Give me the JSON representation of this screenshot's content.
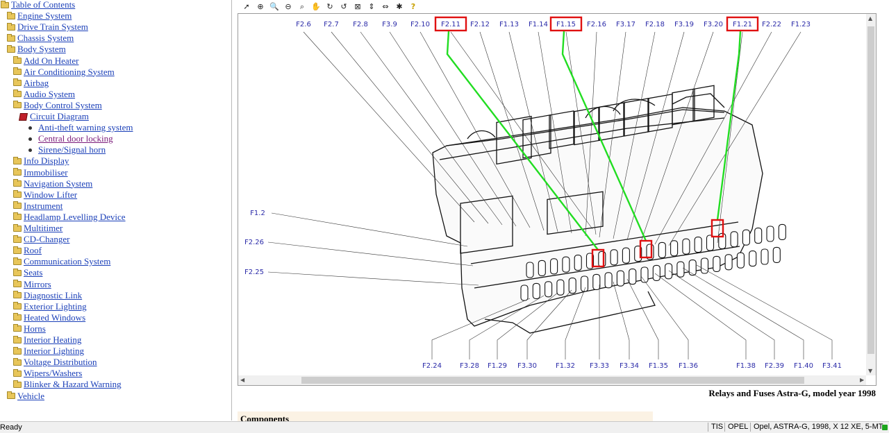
{
  "tree": {
    "items": [
      {
        "label": "Table of Contents",
        "icon": "open-folder-icon",
        "indent": 0
      },
      {
        "label": "Engine System",
        "icon": "folder-icon",
        "indent": 1
      },
      {
        "label": "Drive Train System",
        "icon": "folder-icon",
        "indent": 1
      },
      {
        "label": "Chassis System",
        "icon": "folder-icon",
        "indent": 1
      },
      {
        "label": "Body System",
        "icon": "open-folder-icon",
        "indent": 1
      },
      {
        "label": "Add On Heater",
        "icon": "folder-icon",
        "indent": 2
      },
      {
        "label": "Air Conditioning System",
        "icon": "folder-icon",
        "indent": 2
      },
      {
        "label": "Airbag",
        "icon": "folder-icon",
        "indent": 2
      },
      {
        "label": "Audio System",
        "icon": "folder-icon",
        "indent": 2
      },
      {
        "label": "Body Control System",
        "icon": "open-folder-icon",
        "indent": 2
      },
      {
        "label": "Circuit Diagram",
        "icon": "book-icon",
        "indent": 3
      },
      {
        "label": "Anti-theft warning system",
        "icon": "bullet-icon",
        "indent": 4
      },
      {
        "label": "Central door locking",
        "icon": "bullet-icon",
        "indent": 4,
        "visited": true
      },
      {
        "label": "Sirene/Signal horn",
        "icon": "bullet-icon",
        "indent": 4
      },
      {
        "label": "Info Display",
        "icon": "folder-icon",
        "indent": 2
      },
      {
        "label": "Immobiliser",
        "icon": "folder-icon",
        "indent": 2
      },
      {
        "label": "Navigation System",
        "icon": "folder-icon",
        "indent": 2
      },
      {
        "label": "Window Lifter",
        "icon": "folder-icon",
        "indent": 2
      },
      {
        "label": "Instrument",
        "icon": "folder-icon",
        "indent": 2
      },
      {
        "label": "Headlamp Levelling Device",
        "icon": "folder-icon",
        "indent": 2
      },
      {
        "label": "Multitimer",
        "icon": "folder-icon",
        "indent": 2
      },
      {
        "label": "CD-Changer",
        "icon": "folder-icon",
        "indent": 2
      },
      {
        "label": "Roof",
        "icon": "folder-icon",
        "indent": 2
      },
      {
        "label": "Communication System",
        "icon": "folder-icon",
        "indent": 2
      },
      {
        "label": "Seats",
        "icon": "folder-icon",
        "indent": 2
      },
      {
        "label": "Mirrors",
        "icon": "folder-icon",
        "indent": 2
      },
      {
        "label": "Diagnostic Link",
        "icon": "folder-icon",
        "indent": 2
      },
      {
        "label": "Exterior Lighting",
        "icon": "folder-icon",
        "indent": 2
      },
      {
        "label": "Heated Windows",
        "icon": "folder-icon",
        "indent": 2
      },
      {
        "label": "Horns",
        "icon": "folder-icon",
        "indent": 2
      },
      {
        "label": "Interior Heating",
        "icon": "folder-icon",
        "indent": 2
      },
      {
        "label": "Interior Lighting",
        "icon": "folder-icon",
        "indent": 2
      },
      {
        "label": "Voltage Distribution",
        "icon": "folder-icon",
        "indent": 2
      },
      {
        "label": "Wipers/Washers",
        "icon": "folder-icon",
        "indent": 2
      },
      {
        "label": "Blinker & Hazard Warning",
        "icon": "folder-icon",
        "indent": 2
      },
      {
        "label": "Vehicle",
        "icon": "folder-icon",
        "indent": 1
      }
    ]
  },
  "toolbar": {
    "tools": [
      "select-arrow-icon",
      "zoom-in-area-icon",
      "zoom-in-icon",
      "zoom-out-icon",
      "zoom-fit-icon",
      "hand-pan-icon",
      "rotate-cw-icon",
      "rotate-ccw-icon",
      "fit-window-icon",
      "fit-height-icon",
      "fit-width-icon",
      "magic-icon",
      "help-icon"
    ]
  },
  "diagram": {
    "top_labels": [
      "F2.6",
      "F2.7",
      "F2.8",
      "F3.9",
      "F2.10",
      "F2.11",
      "F2.12",
      "F1.13",
      "F1.14",
      "F1.15",
      "F2.16",
      "F3.17",
      "F2.18",
      "F3.19",
      "F3.20",
      "F1.21",
      "F2.22",
      "F1.23"
    ],
    "bottom_labels": [
      "F2.24",
      "F3.28",
      "F1.29",
      "F3.30",
      "F1.32",
      "F3.33",
      "F3.34",
      "F1.35",
      "F1.36",
      "F1.38",
      "F2.39",
      "F1.40",
      "F3.41"
    ],
    "left_labels": [
      "F1.2",
      "F2.26",
      "F2.25"
    ],
    "highlighted": [
      "F2.11",
      "F1.15",
      "F1.21"
    ],
    "highlight_color": "#e01010",
    "line_color": "#22dd22"
  },
  "caption": "Relays and Fuses Astra-G, model year 1998",
  "components_header": "Components",
  "status": {
    "left": "Ready",
    "panels": [
      "TIS",
      "OPEL",
      "Opel, ASTRA-G, 1998, X 12 XE, 5-MT"
    ]
  }
}
